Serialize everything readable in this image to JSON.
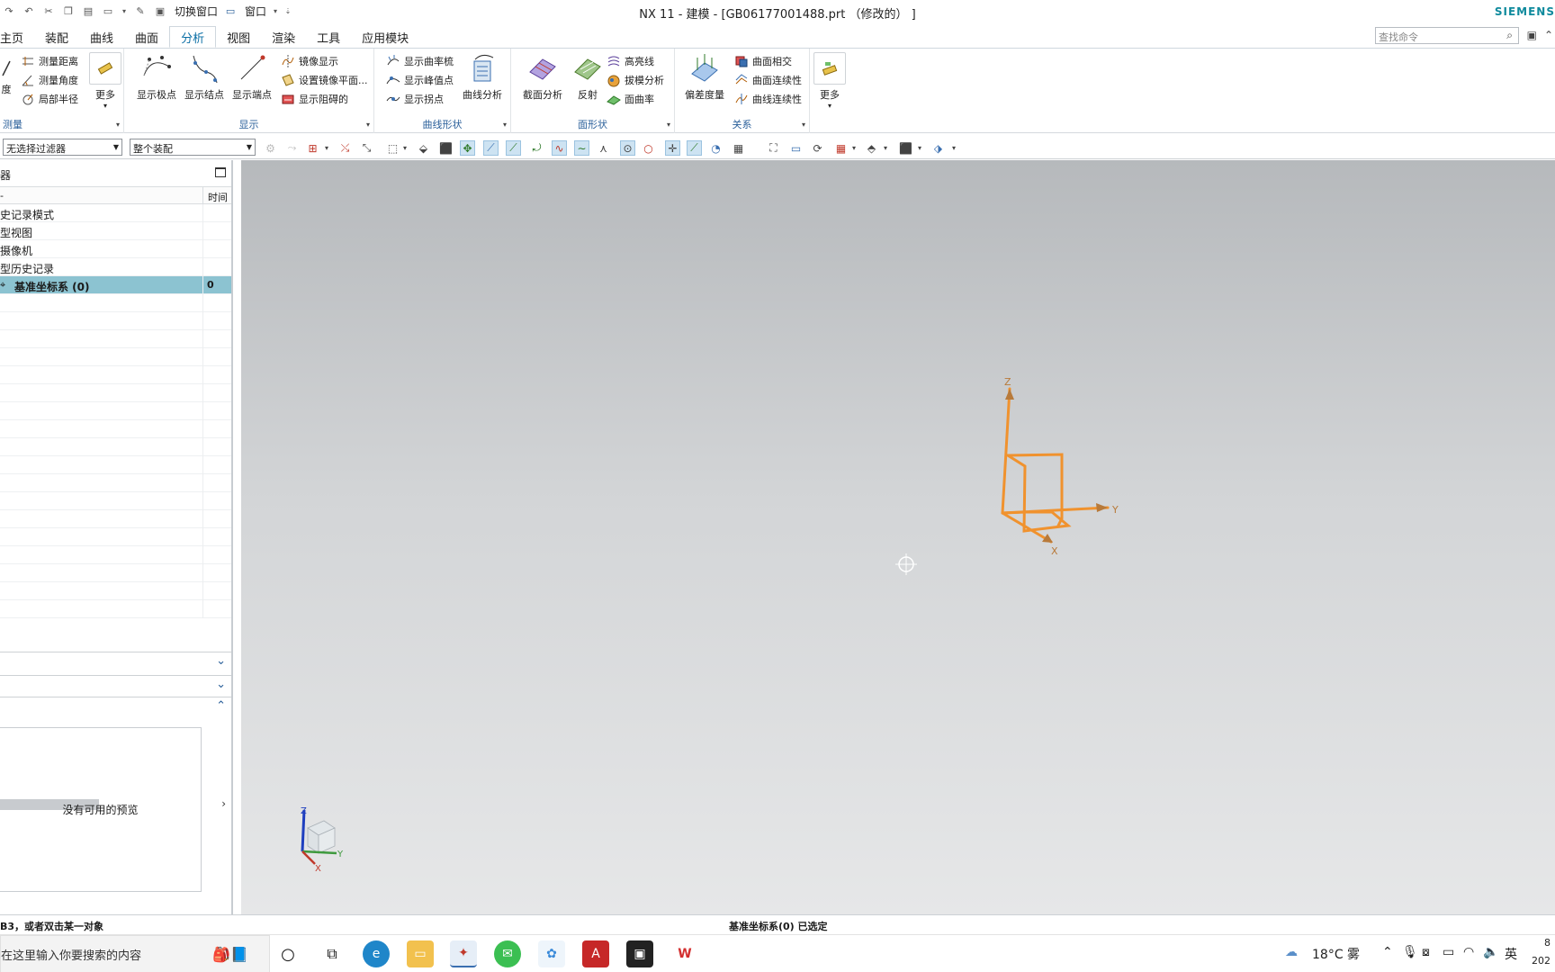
{
  "window": {
    "title": "NX 11 - 建模 - [GB06177001488.prt （修改的） ]",
    "brand": "SIEMENS",
    "quick_switch_label": "切换窗口",
    "quick_window_label": "窗口"
  },
  "tabs": [
    "主页",
    "装配",
    "曲线",
    "曲面",
    "分析",
    "视图",
    "渲染",
    "工具",
    "应用模块"
  ],
  "active_tab": "分析",
  "command_search": {
    "placeholder": "查找命令"
  },
  "ribbon": {
    "measure": {
      "label": "测量",
      "partial_big": "度",
      "small": [
        "测量距离",
        "测量角度",
        "局部半径"
      ],
      "more": "更多"
    },
    "display": {
      "label": "显示",
      "big": [
        "显示极点",
        "显示结点",
        "显示端点"
      ],
      "small": [
        "镜像显示",
        "设置镜像平面...",
        "显示阻碍的"
      ]
    },
    "curve_shape": {
      "label": "曲线形状",
      "small": [
        "显示曲率梳",
        "显示峰值点",
        "显示拐点"
      ],
      "big": [
        "曲线分析"
      ]
    },
    "face_shape": {
      "label": "面形状",
      "big": [
        "截面分析",
        "反射"
      ],
      "small": [
        "高亮线",
        "拔模分析",
        "面曲率"
      ]
    },
    "relation": {
      "label": "关系",
      "big": [
        "偏差度量"
      ],
      "small": [
        "曲面相交",
        "曲面连续性",
        "曲线连续性"
      ]
    },
    "more": {
      "label": "更多"
    }
  },
  "selection_bar": {
    "filter": "无选择过滤器",
    "scope": "整个装配"
  },
  "navigator": {
    "title": "器",
    "col_name": "-",
    "col_time": "时间",
    "rows": [
      {
        "name": "史记录模式",
        "time": ""
      },
      {
        "name": "型视图",
        "time": ""
      },
      {
        "name": "摄像机",
        "time": ""
      },
      {
        "name": "型历史记录",
        "time": ""
      },
      {
        "name": "基准坐标系 (0)",
        "time": "0"
      }
    ],
    "preview_text": "没有可用的预览"
  },
  "status": {
    "left": "B3，或者双击某一对象",
    "middle": "基准坐标系(0) 已选定"
  },
  "axis_labels": {
    "x": "X",
    "y": "Y",
    "z": "Z"
  },
  "taskbar": {
    "search_text": "在这里输入你要搜索的内容",
    "weather": "18°C 雾",
    "ime": "英",
    "time_partial": "8",
    "date_partial": "202"
  },
  "colors": {
    "accent": "#0a6ea5",
    "brand": "#0f8a9d",
    "selection_row": "#8cc3d1",
    "csys_orange": "#f0922e"
  }
}
